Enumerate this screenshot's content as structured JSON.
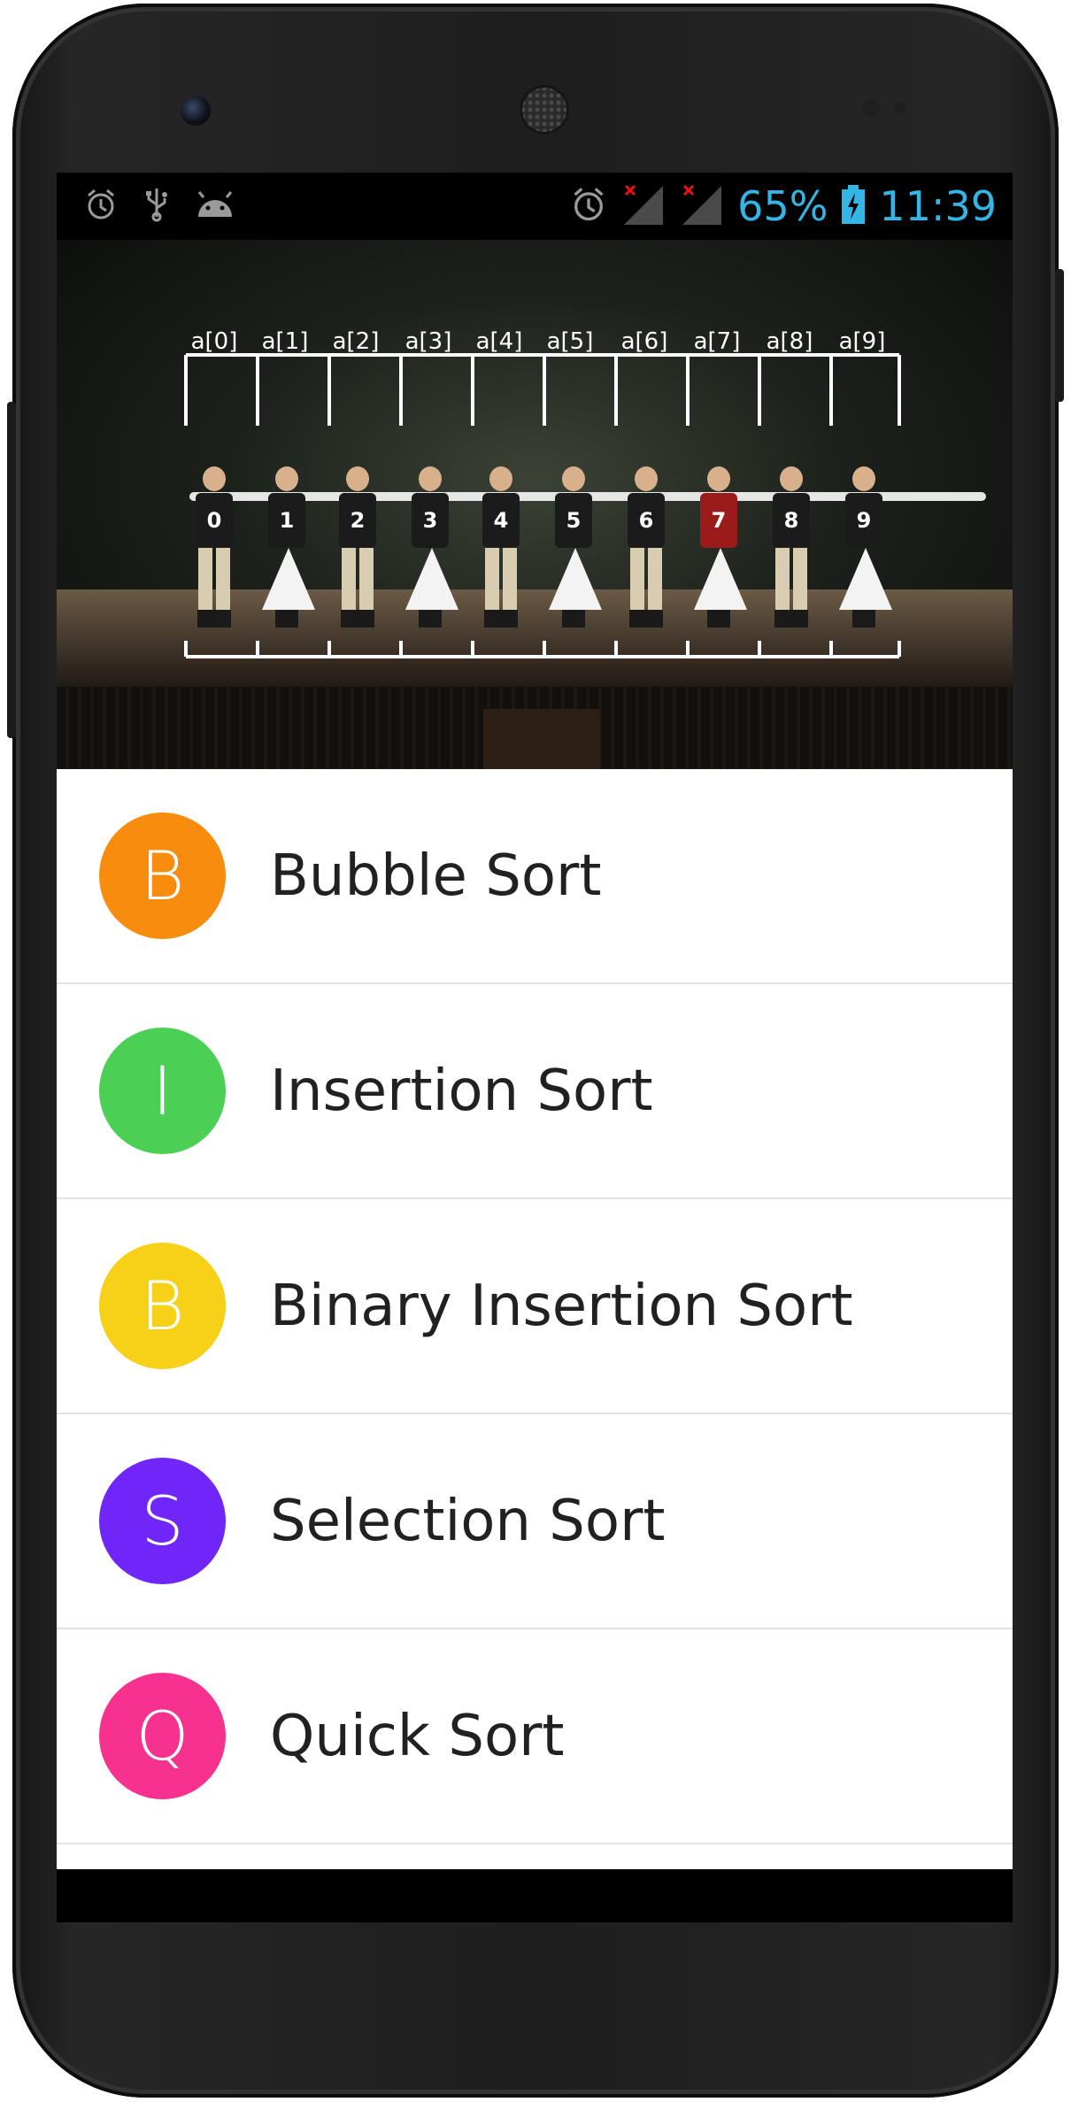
{
  "status_bar": {
    "battery_percent": "65%",
    "time": "11:39",
    "left_icons": [
      "alarm-icon",
      "usb-icon",
      "android-debug-icon"
    ],
    "right_icons": [
      "alarm-icon",
      "signal-off-icon",
      "signal-off-icon",
      "battery-charging-icon"
    ],
    "accent_color": "#33b5e5"
  },
  "banner": {
    "array_labels": [
      "a[0]",
      "a[1]",
      "a[2]",
      "a[3]",
      "a[4]",
      "a[5]",
      "a[6]",
      "a[7]",
      "a[8]",
      "a[9]"
    ],
    "dancer_numbers": [
      "0",
      "1",
      "2",
      "3",
      "4",
      "5",
      "6",
      "7",
      "8",
      "9"
    ]
  },
  "list": {
    "items": [
      {
        "initial": "B",
        "label": "Bubble Sort",
        "color": "#f78c0e"
      },
      {
        "initial": "I",
        "label": "Insertion Sort",
        "color": "#4bcf55"
      },
      {
        "initial": "B",
        "label": "Binary Insertion Sort",
        "color": "#f7d117"
      },
      {
        "initial": "S",
        "label": "Selection Sort",
        "color": "#7026f9"
      },
      {
        "initial": "Q",
        "label": "Quick Sort",
        "color": "#f7318e"
      }
    ]
  }
}
